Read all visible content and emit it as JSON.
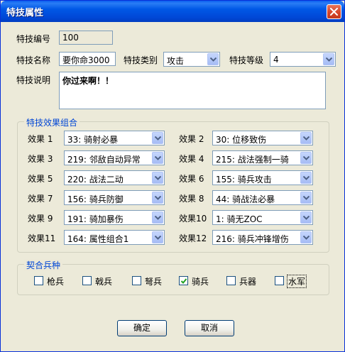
{
  "window": {
    "title": "特技属性"
  },
  "form": {
    "id_label": "特技编号",
    "id_value": "100",
    "name_label": "特技名称",
    "name_value": "要你命3000",
    "type_label": "特技类别",
    "type_value": "攻击",
    "level_label": "特技等级",
    "level_value": "4",
    "desc_label": "特技说明",
    "desc_value": "你过来啊！！"
  },
  "effects_group": {
    "title": "特技效果组合",
    "items": [
      {
        "label": "效果 1",
        "value": "33: 骑射必暴"
      },
      {
        "label": "效果 2",
        "value": "30: 位移致伤"
      },
      {
        "label": "效果 3",
        "value": "219: 邻敌自动异常"
      },
      {
        "label": "效果 4",
        "value": "215: 战法强制一骑"
      },
      {
        "label": "效果 5",
        "value": "220: 战法二动"
      },
      {
        "label": "效果 6",
        "value": "155: 骑兵攻击"
      },
      {
        "label": "效果 7",
        "value": "156: 骑兵防御"
      },
      {
        "label": "效果 8",
        "value": "44: 骑战法必暴"
      },
      {
        "label": "效果 9",
        "value": "191: 骑加暴伤"
      },
      {
        "label": "效果10",
        "value": "1: 骑无ZOC"
      },
      {
        "label": "效果11",
        "value": "164: 属性组合1"
      },
      {
        "label": "效果12",
        "value": "216: 骑兵冲锋增伤"
      }
    ]
  },
  "troops_group": {
    "title": "契合兵种",
    "items": [
      {
        "label": "枪兵",
        "checked": false
      },
      {
        "label": "戟兵",
        "checked": false
      },
      {
        "label": "弩兵",
        "checked": false
      },
      {
        "label": "骑兵",
        "checked": true
      },
      {
        "label": "兵器",
        "checked": false
      },
      {
        "label": "水军",
        "checked": false
      }
    ]
  },
  "buttons": {
    "ok": "确定",
    "cancel": "取消"
  },
  "colors": {
    "titlebar": "#0058e6",
    "group_title": "#0046d5",
    "dialog_bg": "#ece9d8",
    "check_mark": "#21a121"
  }
}
